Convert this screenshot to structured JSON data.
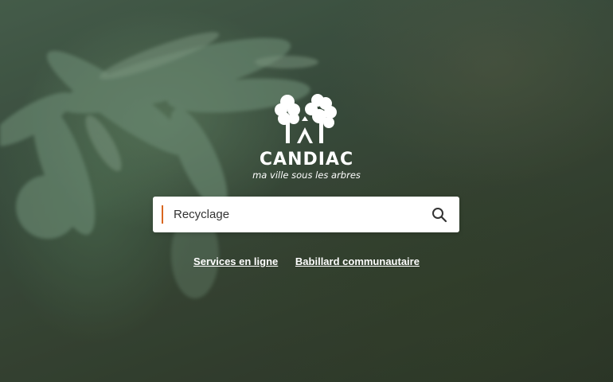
{
  "brand": {
    "name": "CANDIAC",
    "tagline": "ma ville sous les arbres",
    "logo_icon": "trees-logo-icon"
  },
  "search": {
    "value": "Recyclage",
    "caret_color": "#d9661f",
    "icon": "search-icon"
  },
  "links": [
    {
      "label": "Services en ligne"
    },
    {
      "label": "Babillard communautaire"
    }
  ],
  "background": {
    "description_icon": "cedar-foliage-background"
  }
}
